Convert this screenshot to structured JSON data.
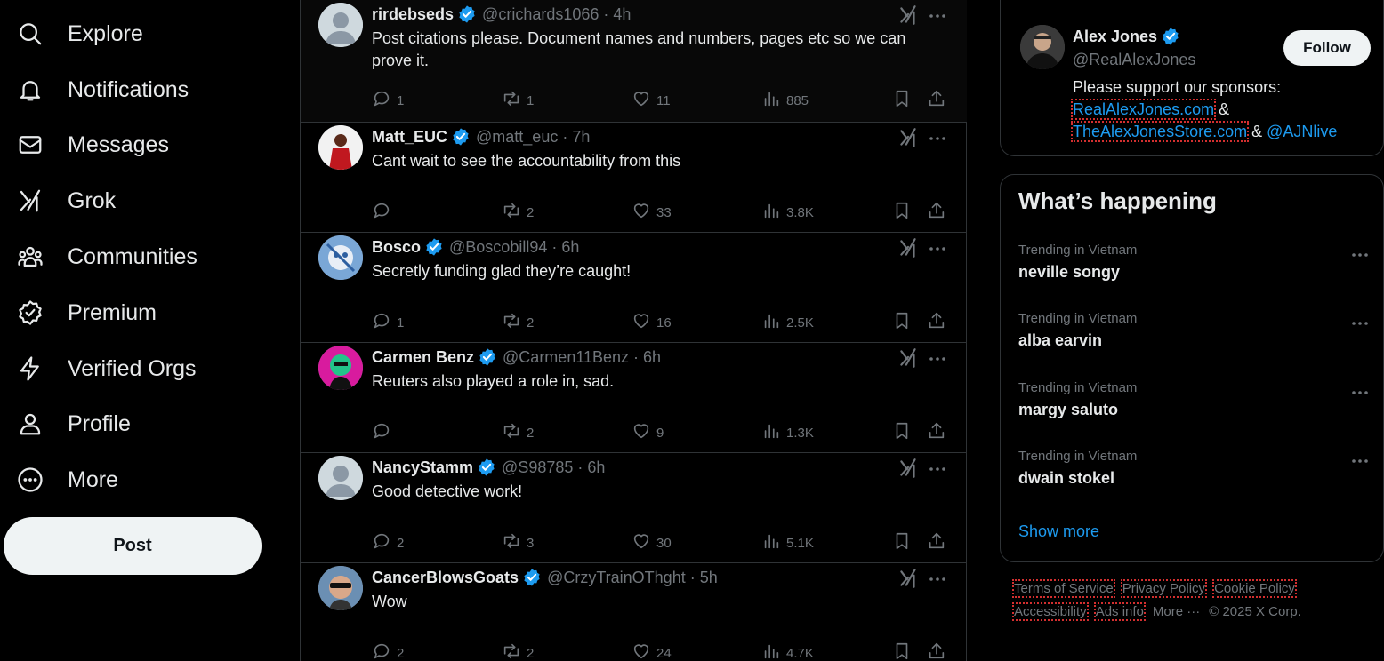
{
  "nav": {
    "items": [
      {
        "label": "Explore",
        "icon": "search-icon"
      },
      {
        "label": "Notifications",
        "icon": "bell-icon"
      },
      {
        "label": "Messages",
        "icon": "envelope-icon"
      },
      {
        "label": "Grok",
        "icon": "grok-icon"
      },
      {
        "label": "Communities",
        "icon": "people-icon"
      },
      {
        "label": "Premium",
        "icon": "premium-badge-icon"
      },
      {
        "label": "Verified Orgs",
        "icon": "lightning-icon"
      },
      {
        "label": "Profile",
        "icon": "person-icon"
      },
      {
        "label": "More",
        "icon": "more-circle-icon"
      }
    ],
    "post_label": "Post"
  },
  "feed": {
    "tweets": [
      {
        "name": "rirdebseds",
        "handle": "@crichards1066",
        "time": "4h",
        "text": "Post citations please. Document names and numbers, pages etc so we can prove it.",
        "replies": "1",
        "reposts": "1",
        "likes": "11",
        "views": "885"
      },
      {
        "name": "Matt_EUC",
        "handle": "@matt_euc",
        "time": "7h",
        "text": "Cant wait to see the accountability from this",
        "replies": "",
        "reposts": "2",
        "likes": "33",
        "views": "3.8K"
      },
      {
        "name": "Bosco",
        "handle": "@Boscobill94",
        "time": "6h",
        "text": "Secretly funding glad they’re caught!",
        "replies": "1",
        "reposts": "2",
        "likes": "16",
        "views": "2.5K"
      },
      {
        "name": "Carmen Benz",
        "handle": "@Carmen11Benz",
        "time": "6h",
        "text": "Reuters also played a role in, sad.",
        "replies": "",
        "reposts": "2",
        "likes": "9",
        "views": "1.3K"
      },
      {
        "name": "NancyStamm",
        "handle": "@S98785",
        "time": "6h",
        "text": "Good detective work!",
        "replies": "2",
        "reposts": "3",
        "likes": "30",
        "views": "5.1K"
      },
      {
        "name": "CancerBlowsGoats",
        "handle": "@CrzyTrainOThght",
        "time": "5h",
        "text": "Wow",
        "replies": "2",
        "reposts": "2",
        "likes": "24",
        "views": "4.7K"
      }
    ]
  },
  "promo": {
    "name": "Alex Jones",
    "handle": "@RealAlexJones",
    "follow_label": "Follow",
    "bio_text": "Please support our sponsors:",
    "link1": "RealAlexJones.com",
    "amp1": " &",
    "link2": "TheAlexJonesStore.com",
    "amp2": " & ",
    "link3": "@AJNlive"
  },
  "trends": {
    "title": "What’s happening",
    "items": [
      {
        "context": "Trending in Vietnam",
        "name": "neville songy"
      },
      {
        "context": "Trending in Vietnam",
        "name": "alba earvin"
      },
      {
        "context": "Trending in Vietnam",
        "name": "margy saluto"
      },
      {
        "context": "Trending in Vietnam",
        "name": "dwain stokel"
      }
    ],
    "show_more": "Show more"
  },
  "footer": {
    "terms": "Terms of Service",
    "privacy": "Privacy Policy",
    "cookie": "Cookie Policy",
    "accessibility": "Accessibility",
    "ads": "Ads info",
    "more": "More ···",
    "copyright": "© 2025 X Corp."
  },
  "colors": {
    "accent": "#1d9bf0",
    "muted": "#71767b",
    "text": "#e7e9ea",
    "border": "#2f3336"
  }
}
